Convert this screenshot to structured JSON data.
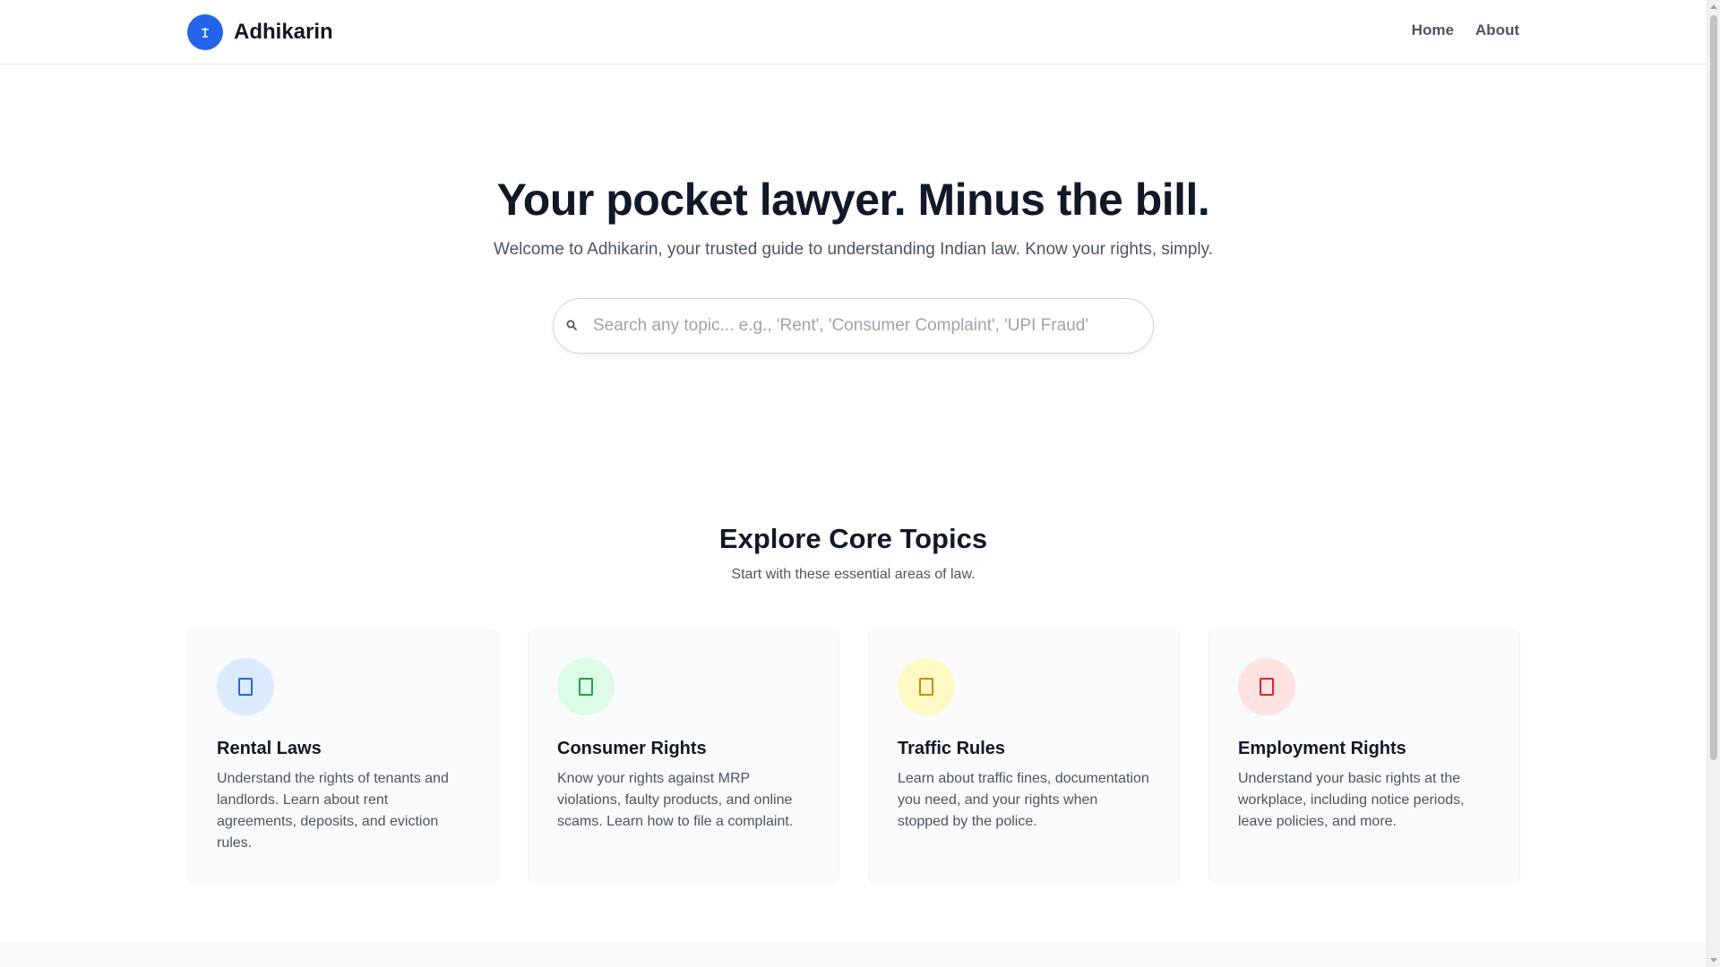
{
  "header": {
    "brand_name": "Adhikarin",
    "logo_icon": "scale-icon",
    "nav": [
      {
        "label": "Home"
      },
      {
        "label": "About"
      }
    ]
  },
  "hero": {
    "title": "Your pocket lawyer. Minus the bill.",
    "subtitle": "Welcome to Adhikarin, your trusted guide to understanding Indian law. Know your rights, simply.",
    "search": {
      "placeholder": "Search any topic... e.g., 'Rent', 'Consumer Complaint', 'UPI Fraud'",
      "value": "",
      "icon": "search-icon"
    }
  },
  "topics": {
    "title": "Explore Core Topics",
    "subtitle": "Start with these essential areas of law.",
    "cards": [
      {
        "title": "Rental Laws",
        "description": "Understand the rights of tenants and landlords. Learn about rent agreements, deposits, and eviction rules.",
        "icon": "building-icon",
        "icon_bg": "#dbeafe",
        "icon_color": "#2563eb"
      },
      {
        "title": "Consumer Rights",
        "description": "Know your rights against MRP violations, faulty products, and online scams. Learn how to file a complaint.",
        "icon": "shopping-bag-icon",
        "icon_bg": "#dcfce7",
        "icon_color": "#16a34a"
      },
      {
        "title": "Traffic Rules",
        "description": "Learn about traffic fines, documentation you need, and your rights when stopped by the police.",
        "icon": "car-icon",
        "icon_bg": "#fef9c3",
        "icon_color": "#ca8a04"
      },
      {
        "title": "Employment Rights",
        "description": "Understand your basic rights at the workplace, including notice periods, leave policies, and more.",
        "icon": "briefcase-icon",
        "icon_bg": "#fee2e2",
        "icon_color": "#dc2626"
      }
    ]
  },
  "colors": {
    "brand": "#2563eb",
    "text_primary": "#111827",
    "text_secondary": "#4b5563"
  }
}
